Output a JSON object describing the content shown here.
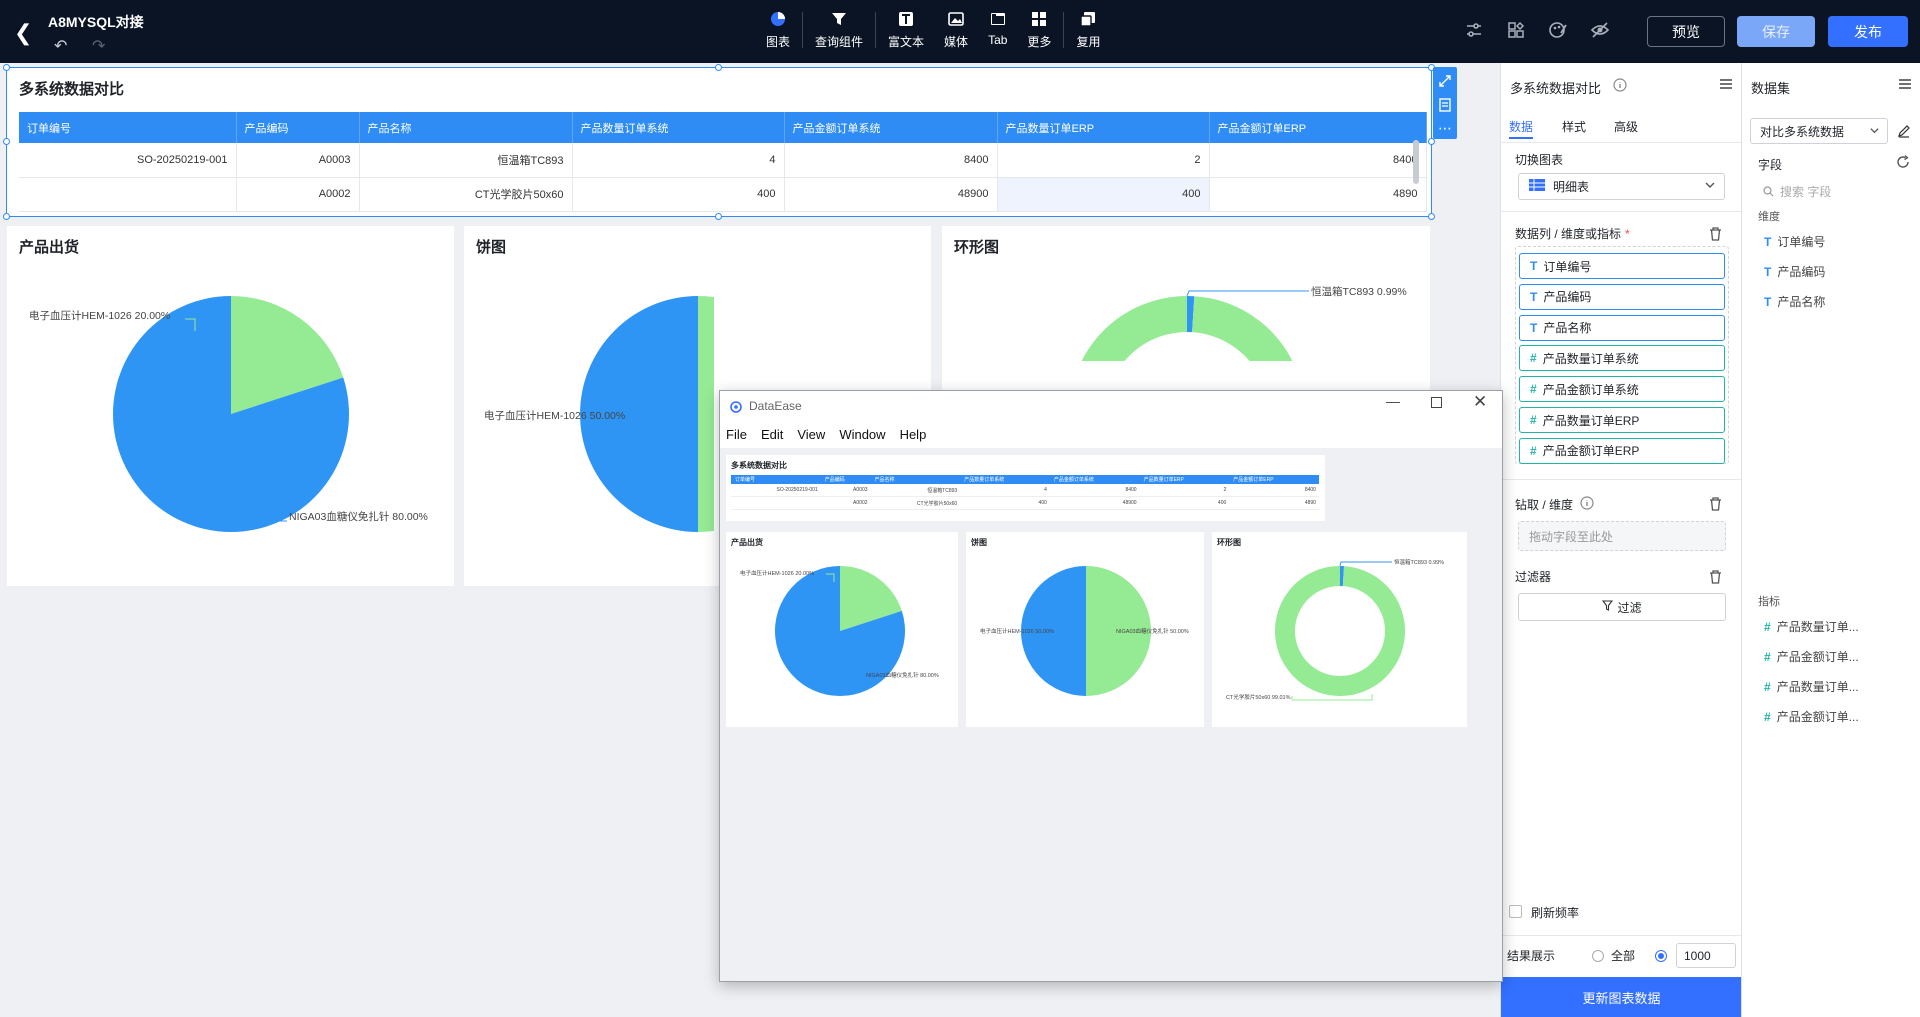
{
  "header": {
    "title": "A8MYSQL对接",
    "toolbar": [
      {
        "label": "图表",
        "icon": "chart-icon"
      },
      {
        "label": "查询组件",
        "icon": "filter-icon"
      },
      {
        "label": "富文本",
        "icon": "text-icon"
      },
      {
        "label": "媒体",
        "icon": "image-icon"
      },
      {
        "label": "Tab",
        "icon": "tab-icon"
      },
      {
        "label": "更多",
        "icon": "grid-icon"
      },
      {
        "label": "复用",
        "icon": "copy-icon"
      }
    ],
    "preview_label": "预览",
    "save_label": "保存",
    "publish_label": "发布",
    "colors": {
      "bar": "#0b1425",
      "accent": "#3370ff",
      "save": "#7aa7f7"
    }
  },
  "table_card": {
    "title": "多系统数据对比",
    "columns": [
      "订单编号",
      "产品编码",
      "产品名称",
      "产品数量订单系统",
      "产品金额订单系统",
      "产品数量订单ERP",
      "产品金额订单ERP"
    ],
    "rows": [
      [
        "SO-20250219-001",
        "A0003",
        "恒温箱TC893",
        "4",
        "8400",
        "2",
        "8400"
      ],
      [
        "",
        "A0002",
        "CT光学胶片50x60",
        "400",
        "48900",
        "400",
        "4890"
      ]
    ]
  },
  "charts": [
    {
      "title": "产品出货",
      "chart_data": {
        "type": "pie",
        "slices": [
          {
            "name": "电子血压计HEM-1026",
            "value": 20.0,
            "label": "电子血压计HEM-1026 20.00%",
            "color": "#95ea94"
          },
          {
            "name": "NIGA03血糖仪免扎针",
            "value": 80.0,
            "label": "NIGA03血糖仪免扎针 80.00%",
            "color": "#2f95f5"
          }
        ]
      }
    },
    {
      "title": "饼图",
      "chart_data": {
        "type": "pie",
        "slices": [
          {
            "name": "电子血压计HEM-1026",
            "value": 50.0,
            "label": "电子血压计HEM-1026 50.00%",
            "color": "#95ea94"
          },
          {
            "name": "NIGA03血糖仪免扎针",
            "value": 50.0,
            "label": "NIGA03血糖仪免扎针 50.00%",
            "color": "#2f95f5"
          }
        ]
      }
    },
    {
      "title": "环形图",
      "chart_data": {
        "type": "pie",
        "donut": true,
        "slices": [
          {
            "name": "恒温箱TC893",
            "value": 0.99,
            "label": "恒温箱TC893 0.99%",
            "color": "#2f95f5"
          },
          {
            "name": "CT光学胶片50x60",
            "value": 99.01,
            "label": "CT光学胶片50x60 99.01%",
            "color": "#95ea94"
          }
        ]
      }
    }
  ],
  "properties_panel": {
    "title": "多系统数据对比",
    "tabs": [
      "数据",
      "样式",
      "高级"
    ],
    "switch_chart_label": "切换图表",
    "chart_type": "明细表",
    "columns_label": "数据列 / 维度或指标",
    "required_mark": "*",
    "fields": [
      {
        "kind": "T",
        "name": "订单编号"
      },
      {
        "kind": "T",
        "name": "产品编码"
      },
      {
        "kind": "T",
        "name": "产品名称"
      },
      {
        "kind": "#",
        "name": "产品数量订单系统"
      },
      {
        "kind": "#",
        "name": "产品金额订单系统"
      },
      {
        "kind": "#",
        "name": "产品数量订单ERP"
      },
      {
        "kind": "#",
        "name": "产品金额订单ERP"
      }
    ],
    "drill_label": "钻取 / 维度",
    "drill_placeholder": "拖动字段至此处",
    "filter_label": "过滤器",
    "filter_button": "过滤",
    "refresh_label": "刷新频率",
    "result_label": "结果展示",
    "result_all": "全部",
    "result_count": "1000",
    "update_button": "更新图表数据"
  },
  "dataset_panel": {
    "title": "数据集",
    "dataset_name": "对比多系统数据",
    "fields_label": "字段",
    "search_placeholder": "搜索 字段",
    "dimension_label": "维度",
    "dimensions": [
      "订单编号",
      "产品编码",
      "产品名称"
    ],
    "measure_label": "指标",
    "measures": [
      "产品数量订单...",
      "产品金额订单...",
      "产品数量订单...",
      "产品金额订单..."
    ]
  },
  "popup_window": {
    "app_name": "DataEase",
    "menu": [
      "File",
      "Edit",
      "View",
      "Window",
      "Help"
    ],
    "preview_title": "多系统数据对比"
  }
}
